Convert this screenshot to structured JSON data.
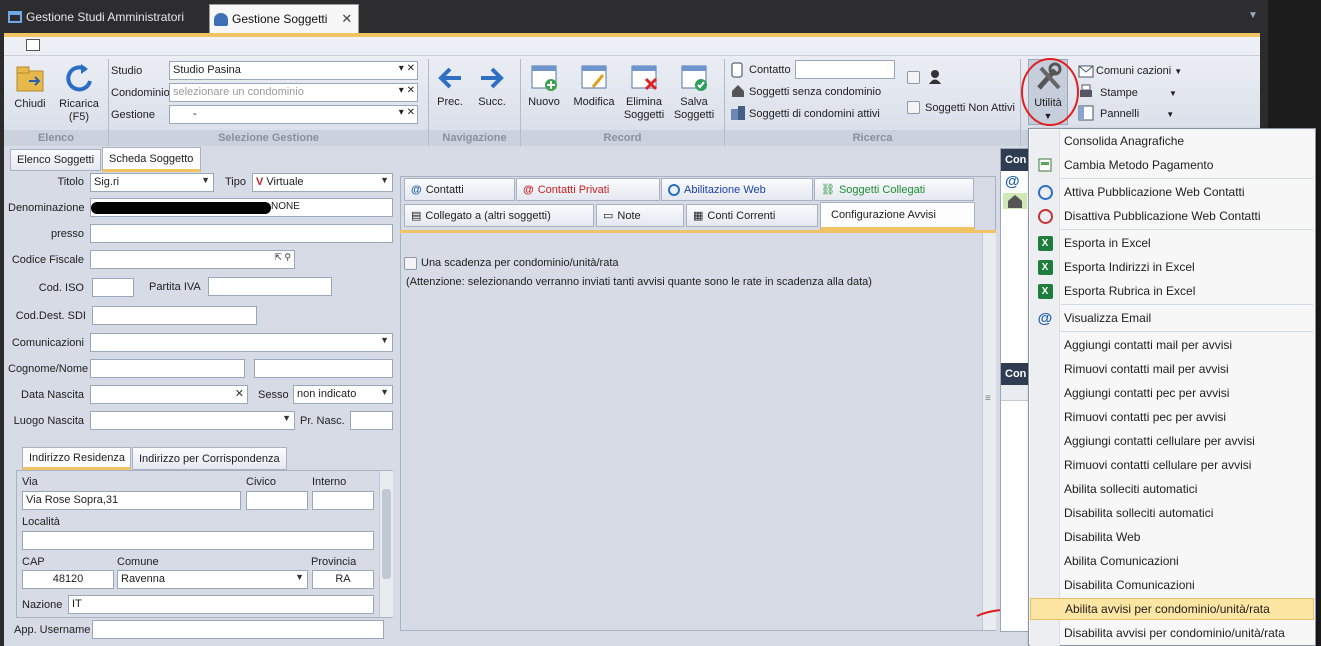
{
  "tabs": [
    {
      "label": "Gestione Studi Amministratori"
    },
    {
      "label": "Gestione Soggetti"
    }
  ],
  "ribbon": {
    "buttons": {
      "chiudi": "Chiudi",
      "ricarica": "Ricarica",
      "ricarica_key": "(F5)",
      "prec": "Prec.",
      "succ": "Succ.",
      "nuovo": "Nuovo",
      "modifica": "Modifica",
      "elimina": "Elimina",
      "elimina2": "Soggetti",
      "salva": "Salva",
      "salva2": "Soggetti",
      "utilita": "Utilità"
    },
    "selezione": {
      "studio_label": "Studio",
      "studio_value": "Studio Pasina",
      "condominio_label": "Condominio",
      "condominio_placeholder": "selezionare un condominio",
      "gestione_label": "Gestione",
      "gestione_value": "-"
    },
    "ricerca": {
      "contatto_label": "Contatto",
      "contatto_value": "",
      "senza_condominio": "Soggetti senza condominio",
      "condomini_attivi": "Soggetti di condomini attivi",
      "non_attivi": "Soggetti Non Attivi"
    },
    "right_menu": {
      "comunicazioni": "Comuni cazioni",
      "stampe": "Stampe",
      "pannelli": "Pannelli"
    },
    "groups": {
      "elenco": "Elenco",
      "selezione": "Selezione Gestione",
      "navigazione": "Navigazione",
      "record": "Record",
      "ricerca": "Ricerca"
    }
  },
  "view_tabs": [
    "Elenco Soggetti",
    "Scheda Soggetto"
  ],
  "form": {
    "titolo_label": "Titolo",
    "titolo_value": "Sig.ri",
    "tipo_label": "Tipo",
    "tipo_value": "Virtuale",
    "denominazione_label": "Denominazione",
    "denominazione_value": "NONE",
    "presso_label": "presso",
    "codice_fiscale_label": "Codice Fiscale",
    "cod_iso_label": "Cod. ISO",
    "partita_iva_label": "Partita IVA",
    "cod_dest_sdi_label": "Cod.Dest. SDI",
    "comunicazioni_label": "Comunicazioni",
    "cognome_nome_label": "Cognome/Nome",
    "data_nascita_label": "Data Nascita",
    "sesso_label": "Sesso",
    "sesso_value": "non indicato",
    "luogo_nascita_label": "Luogo Nascita",
    "pr_nasc_label": "Pr. Nasc.",
    "address_tabs": [
      "Indirizzo Residenza",
      "Indirizzo per Corrispondenza"
    ],
    "via_label": "Via",
    "via_value": "Via Rose Sopra,31",
    "civico_label": "Civico",
    "interno_label": "Interno",
    "localita_label": "Località",
    "cap_label": "CAP",
    "cap_value": "48120",
    "comune_label": "Comune",
    "comune_value": "Ravenna",
    "provincia_label": "Provincia",
    "provincia_value": "RA",
    "nazione_label": "Nazione",
    "nazione_value": "IT",
    "app_username_label": "App. Username"
  },
  "detail_tabs": {
    "row1": [
      "Contatti",
      "Contatti Privati",
      "Abilitazione Web",
      "Soggetti Collegati"
    ],
    "row2": [
      "Collegato a (altri soggetti)",
      "Note",
      "Conti Correnti",
      "Configurazione Avvisi"
    ]
  },
  "avvisi": {
    "checkbox_label": "Una scadenza per condominio/unità/rata",
    "note": "(Attenzione: selezionando verranno inviati tanti avvisi quante sono le rate in scadenza alla data)"
  },
  "side_panel": {
    "header1": "Con",
    "header2": "Con"
  },
  "menu_items": [
    {
      "label": "Consolida Anagrafiche",
      "icon": "consolidate-icon"
    },
    {
      "label": "Cambia Metodo Pagamento",
      "icon": "payment-method-icon"
    },
    {
      "label": "Attiva Pubblicazione Web Contatti",
      "icon": "globe-add-icon"
    },
    {
      "label": "Disattiva Pubblicazione Web Contatti",
      "icon": "globe-remove-icon"
    },
    {
      "label": "Esporta in Excel",
      "icon": "excel-icon"
    },
    {
      "label": "Esporta Indirizzi in Excel",
      "icon": "excel-icon"
    },
    {
      "label": "Esporta Rubrica in Excel",
      "icon": "excel-icon"
    },
    {
      "label": "Visualizza Email",
      "icon": "at-sign-icon"
    },
    {
      "label": "Aggiungi contatti mail per avvisi",
      "icon": ""
    },
    {
      "label": "Rimuovi contatti mail per avvisi",
      "icon": ""
    },
    {
      "label": "Aggiungi contatti pec per avvisi",
      "icon": ""
    },
    {
      "label": "Rimuovi contatti pec per avvisi",
      "icon": ""
    },
    {
      "label": "Aggiungi contatti cellulare per avvisi",
      "icon": ""
    },
    {
      "label": "Rimuovi contatti cellulare per avvisi",
      "icon": ""
    },
    {
      "label": "Abilita solleciti automatici",
      "icon": ""
    },
    {
      "label": "Disabilita solleciti automatici",
      "icon": ""
    },
    {
      "label": "Disabilita Web",
      "icon": ""
    },
    {
      "label": "Abilita Comunicazioni",
      "icon": ""
    },
    {
      "label": "Disabilita Comunicazioni",
      "icon": ""
    },
    {
      "label": "Abilita avvisi per condominio/unità/rata",
      "icon": ""
    },
    {
      "label": "Disabilita avvisi per condominio/unità/rata",
      "icon": ""
    }
  ],
  "colors": {
    "accent": "#f0c462",
    "annotation": "#e02020",
    "highlight": "#fde6a3"
  }
}
